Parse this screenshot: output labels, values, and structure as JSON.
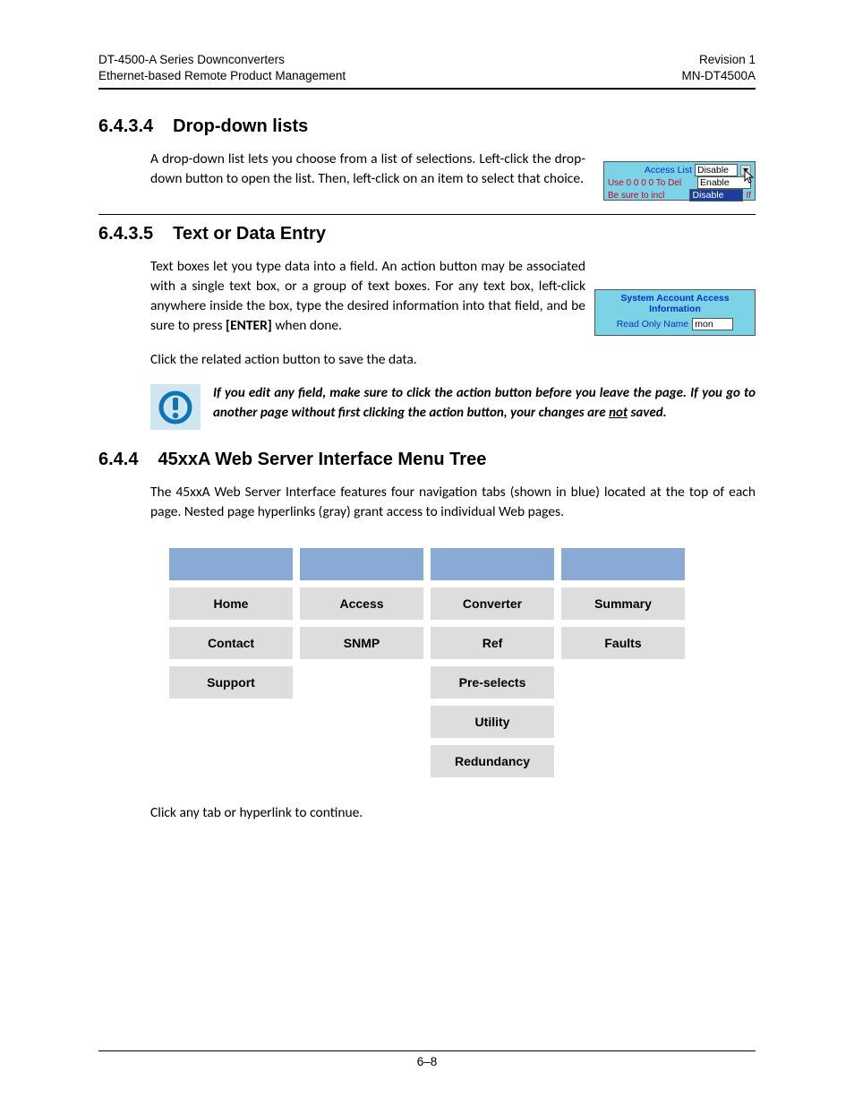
{
  "header": {
    "left_line1": "DT-4500-A Series Downconverters",
    "left_line2": "Ethernet-based Remote Product Management",
    "right_line1": "Revision 1",
    "right_line2": "MN-DT4500A"
  },
  "section_6434": {
    "num": "6.4.3.4",
    "title": "Drop-down lists",
    "body": "A drop-down list lets you choose from a list of selections. Left-click the drop-down button to open the list. Then, left-click on an item to select that choice."
  },
  "dropdown_demo": {
    "label_access": "Access List",
    "selected": "Disable",
    "row2_label": "Use 0 0 0 0 To Del",
    "option_enable": "Enable",
    "row3_label": "Be sure to incl",
    "option_disable": "Disable",
    "trailing": "If"
  },
  "section_6435": {
    "num": "6.4.3.5",
    "title": "Text or Data Entry",
    "body1_a": "Text boxes let you type data into a field. An action button may be associated with a single text box, or a group of text boxes. For any text box, left-click anywhere inside the box, type the desired information into that field, and be sure to press ",
    "body1_bold": "[ENTER]",
    "body1_b": " when done.",
    "body2": "Click the related action button to save the data."
  },
  "textentry_demo": {
    "title": "System Account Access Information",
    "field_label": "Read Only Name",
    "value": "mon"
  },
  "note": {
    "text_a": "If you edit any field, make sure to click the action button before you leave the page. If you go to another page without first clicking the action button, your changes are ",
    "text_not": "not",
    "text_b": " saved."
  },
  "section_644": {
    "num": "6.4.4",
    "title": "45xxA Web Server Interface Menu Tree",
    "body": "The 45xxA Web Server Interface features four navigation tabs (shown in blue) located at the top of each page. Nested page hyperlinks (gray) grant access to individual Web pages.",
    "footer_text": "Click any tab or hyperlink to continue."
  },
  "menu_tree": {
    "cols": [
      [
        "Home",
        "Contact",
        "Support",
        "",
        ""
      ],
      [
        "Access",
        "SNMP",
        "",
        "",
        ""
      ],
      [
        "Converter",
        "Ref",
        "Pre-selects",
        "Utility",
        "Redundancy"
      ],
      [
        "Summary",
        "Faults",
        "",
        "",
        ""
      ]
    ]
  },
  "page_number": "6–8"
}
